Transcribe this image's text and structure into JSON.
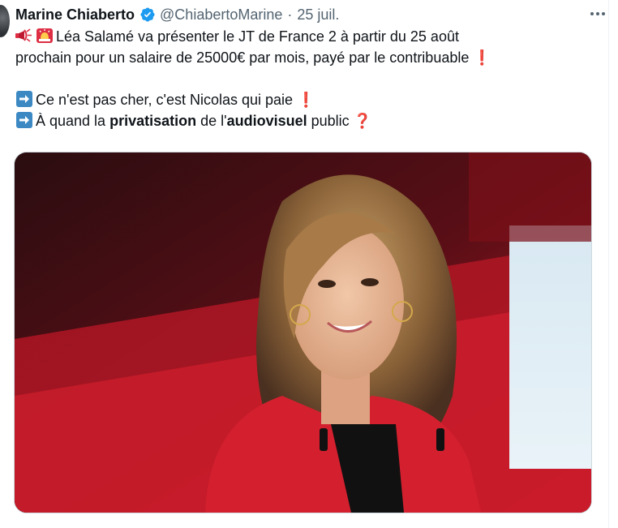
{
  "tweet": {
    "author_name": "Marine Chiaberto",
    "handle": "@ChiabertoMarine",
    "separator": "·",
    "date": "25 juil.",
    "text": {
      "line1": "Léa Salamé va présenter le JT de France 2 à partir du 25 août",
      "line2": "prochain pour un salaire de 25000€ par mois, payé par le contribuable",
      "line3": "Ce n'est pas cher, c'est Nicolas qui paie",
      "line4_a": "À quand la ",
      "line4_b": "privatisation",
      "line4_c": " de l'",
      "line4_d": "audiovisuel",
      "line4_e": " public"
    },
    "glyphs": {
      "exclamation": "❗",
      "question": "❓"
    },
    "icons": [
      "verified-badge-icon",
      "megaphone-icon",
      "siren-icon",
      "right-arrow-icon",
      "more-options-icon"
    ]
  },
  "colors": {
    "verified_blue": "#1d9bf0",
    "text_primary": "#0f1419",
    "text_secondary": "#536471",
    "emoji_red": "#e0245e",
    "arrow_blue": "#3b88c3"
  }
}
